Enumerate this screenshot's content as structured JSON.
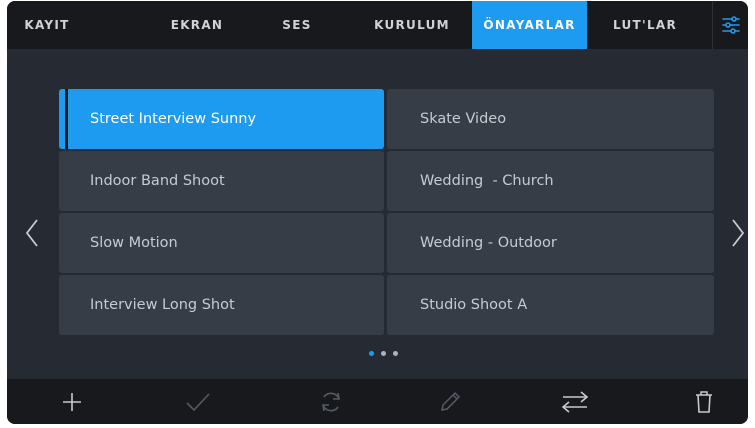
{
  "tabs": [
    {
      "label": "KAYIT",
      "active": false
    },
    {
      "label": "EKRAN",
      "active": false
    },
    {
      "label": "SES",
      "active": false
    },
    {
      "label": "KURULUM",
      "active": false
    },
    {
      "label": "ÖNAYARLAR",
      "active": true
    },
    {
      "label": "LUT'LAR",
      "active": false
    }
  ],
  "presets": [
    [
      "Street Interview Sunny",
      "Skate Video"
    ],
    [
      "Indoor Band Shoot",
      "Wedding  - Church"
    ],
    [
      "Slow Motion",
      "Wedding - Outdoor"
    ],
    [
      "Interview Long Shot",
      "Studio Shoot A"
    ]
  ],
  "selected_preset": "Street Interview Sunny",
  "pagination": {
    "pages": 3,
    "current": 1
  },
  "toolbar_icons": [
    "plus-icon",
    "checkmark-icon",
    "refresh-icon",
    "pencil-icon",
    "swap-arrows-icon",
    "trash-icon"
  ],
  "colors": {
    "accent": "#1d9bf0",
    "background": "#262a32",
    "bar": "#17191d",
    "cell": "#373d47"
  }
}
